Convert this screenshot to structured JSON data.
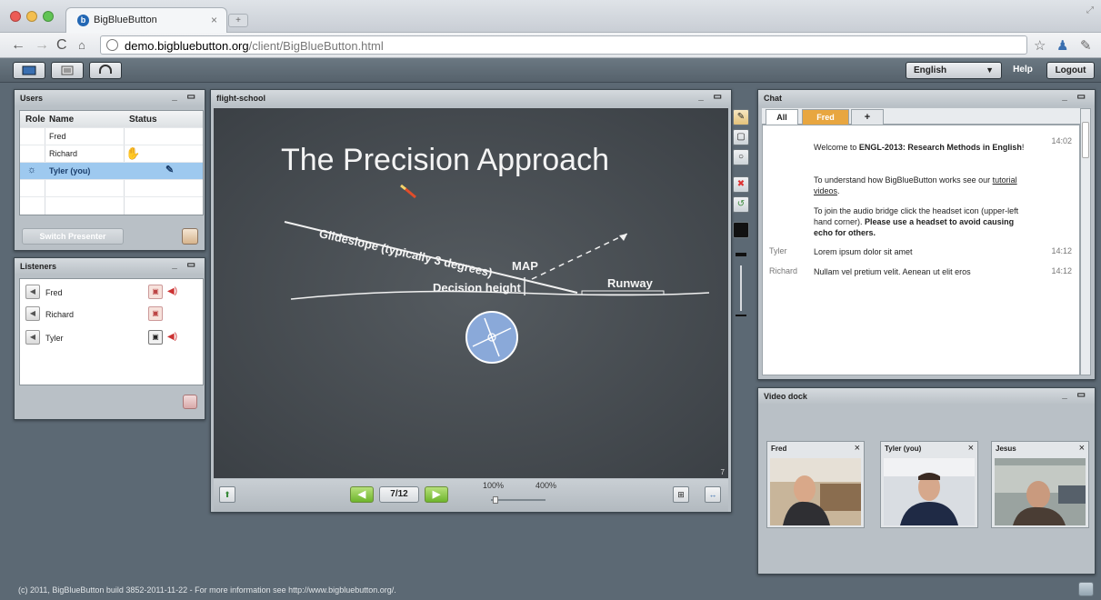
{
  "browser": {
    "tab_title": "BigBlueButton",
    "tab_close": "×",
    "url_host": "demo.bigbluebutton.org",
    "url_path": "/client/BigBlueButton.html"
  },
  "toolbar": {
    "language": "English",
    "help": "Help",
    "logout": "Logout"
  },
  "users": {
    "title": "Users",
    "headers": [
      "Role",
      "Name",
      "Status"
    ],
    "rows": [
      "Fred",
      "Richard",
      "Tyler (you)"
    ],
    "switch_presenter": "Switch Presenter"
  },
  "listeners": {
    "title": "Listeners",
    "rows": [
      "Fred",
      "Richard",
      "Tyler"
    ]
  },
  "presentation": {
    "title": "flight-school",
    "slide_title": "The Precision Approach",
    "label_glideslope": "Glideslope (typically 3 degrees)",
    "label_map": "MAP",
    "label_decision": "Decision height",
    "label_runway": "Runway",
    "slide_number": "7",
    "page": "7/12",
    "zoom_min": "100%",
    "zoom_max": "400%",
    "zoom_level_fraction": 0.05
  },
  "chat": {
    "title": "Chat",
    "tabs": [
      "All",
      "Fred",
      "+"
    ],
    "welcome_time": "14:02",
    "welcome_pre": "Welcome to ",
    "welcome_bold": "ENGL-2013: Research Methods in English",
    "welcome_post": "!",
    "tutorial_pre": "To understand how BigBlueButton works see our ",
    "tutorial_link": "tutorial videos",
    "tutorial_post": ".",
    "audio_pre": "To join the audio bridge click the headset icon (upper-left hand corner). ",
    "audio_bold": "Please use a headset to avoid causing echo for others.",
    "messages": [
      {
        "who": "Tyler",
        "text": "Lorem ipsum dolor sit amet",
        "time": "14:12"
      },
      {
        "who": "Richard",
        "text": "Nullam vel pretium velit. Aenean ut elit eros",
        "time": "14:12"
      }
    ]
  },
  "video": {
    "title": "Video dock",
    "tiles": [
      {
        "name": "Fred",
        "close": "×"
      },
      {
        "name": "Tyler (you)",
        "close": "×"
      },
      {
        "name": "Jesus",
        "close": "×"
      }
    ]
  },
  "footer": {
    "text": "(c) 2011, BigBlueButton build 3852-2011-11-22 - For more information see http://www.bigbluebutton.org/."
  },
  "colors": {
    "app_bg": "#5c6974",
    "fred_tab": "#e8a640",
    "selected_row": "#9ec9ef",
    "board": "#45494d"
  }
}
